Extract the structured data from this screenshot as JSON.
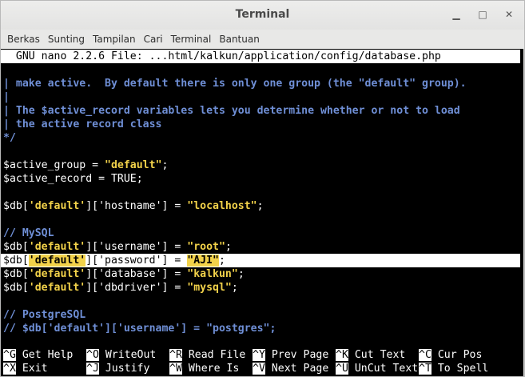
{
  "window": {
    "title": "Terminal"
  },
  "menubar": [
    "Berkas",
    "Sunting",
    "Tampilan",
    "Cari",
    "Terminal",
    "Bantuan"
  ],
  "nano": {
    "header": "  GNU nano 2.2.6 File: ...html/kalkun/application/config/database.php",
    "lines": [
      {
        "segs": [
          {
            "c": "cm",
            "t": "| make active.  By default there is only one group (the \"default\" group)."
          }
        ]
      },
      {
        "segs": [
          {
            "c": "cm",
            "t": "|"
          }
        ]
      },
      {
        "segs": [
          {
            "c": "cm",
            "t": "| The $active_record variables lets you determine whether or not to load"
          }
        ]
      },
      {
        "segs": [
          {
            "c": "cm",
            "t": "| the active record class"
          }
        ]
      },
      {
        "segs": [
          {
            "c": "cm",
            "t": "*/"
          }
        ]
      },
      {
        "segs": []
      },
      {
        "segs": [
          {
            "c": "",
            "t": "$active_group = "
          },
          {
            "c": "st",
            "t": "\"default\""
          },
          {
            "c": "",
            "t": ";"
          }
        ]
      },
      {
        "segs": [
          {
            "c": "",
            "t": "$active_record = TRUE;"
          }
        ]
      },
      {
        "segs": []
      },
      {
        "segs": [
          {
            "c": "",
            "t": "$db["
          },
          {
            "c": "st",
            "t": "'default'"
          },
          {
            "c": "",
            "t": "]['hostname'] = "
          },
          {
            "c": "st",
            "t": "\"localhost\""
          },
          {
            "c": "",
            "t": ";"
          }
        ]
      },
      {
        "segs": []
      },
      {
        "segs": [
          {
            "c": "cm",
            "t": "// MySQL"
          }
        ]
      },
      {
        "segs": [
          {
            "c": "",
            "t": "$db["
          },
          {
            "c": "st",
            "t": "'default'"
          },
          {
            "c": "",
            "t": "]['username'] = "
          },
          {
            "c": "st",
            "t": "\"root\""
          },
          {
            "c": "",
            "t": ";"
          }
        ]
      },
      {
        "hl": true,
        "segs": [
          {
            "c": "k",
            "t": "$db["
          },
          {
            "c": "st2",
            "t": "'default'"
          },
          {
            "c": "k",
            "t": "]['password'] = "
          },
          {
            "c": "st2",
            "t": "\"AJI\""
          },
          {
            "c": "k",
            "t": ";"
          }
        ]
      },
      {
        "segs": [
          {
            "c": "",
            "t": "$db["
          },
          {
            "c": "st",
            "t": "'default'"
          },
          {
            "c": "",
            "t": "]['database'] = "
          },
          {
            "c": "st",
            "t": "\"kalkun\""
          },
          {
            "c": "",
            "t": ";"
          }
        ]
      },
      {
        "segs": [
          {
            "c": "",
            "t": "$db["
          },
          {
            "c": "st",
            "t": "'default'"
          },
          {
            "c": "",
            "t": "]['dbdriver'] = "
          },
          {
            "c": "st",
            "t": "\"mysql\""
          },
          {
            "c": "",
            "t": ";"
          }
        ]
      },
      {
        "segs": []
      },
      {
        "segs": [
          {
            "c": "cm",
            "t": "// PostgreSQL"
          }
        ]
      },
      {
        "segs": [
          {
            "c": "cm",
            "t": "// $db['default']['username'] = \"postgres\";"
          }
        ]
      }
    ],
    "shortcuts": [
      [
        {
          "k": "^G",
          "l": " Get Help"
        },
        {
          "k": "^O",
          "l": " WriteOut"
        },
        {
          "k": "^R",
          "l": " Read File"
        },
        {
          "k": "^Y",
          "l": " Prev Page"
        },
        {
          "k": "^K",
          "l": " Cut Text"
        },
        {
          "k": "^C",
          "l": " Cur Pos"
        }
      ],
      [
        {
          "k": "^X",
          "l": " Exit"
        },
        {
          "k": "^J",
          "l": " Justify"
        },
        {
          "k": "^W",
          "l": " Where Is"
        },
        {
          "k": "^V",
          "l": " Next Page"
        },
        {
          "k": "^U",
          "l": " UnCut Text"
        },
        {
          "k": "^T",
          "l": " To Spell"
        }
      ]
    ]
  }
}
